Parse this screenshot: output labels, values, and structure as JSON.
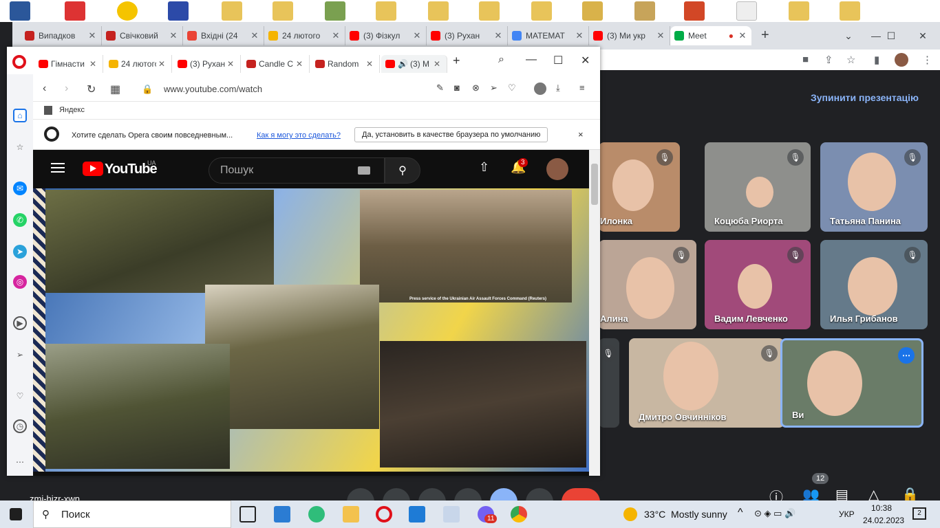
{
  "chrome": {
    "tabs": [
      {
        "label": "Випадков",
        "color": "#c5221f"
      },
      {
        "label": "Свічковий",
        "color": "#c5221f"
      },
      {
        "label": "Вхідні (24",
        "color": "#ea4335"
      },
      {
        "label": "24 лютого",
        "color": "#f5b400"
      },
      {
        "label": "(3) Фізкул",
        "color": "#ff0000"
      },
      {
        "label": "(3) Рухан",
        "color": "#ff0000"
      },
      {
        "label": "МАТЕМАТ",
        "color": "#4285f4"
      },
      {
        "label": "(3) Ми укр",
        "color": "#ff0000"
      },
      {
        "label": "Meet",
        "color": "#00ac47"
      }
    ],
    "new_tab": "+"
  },
  "meet": {
    "stop_presentation": "Зупинити презентацію",
    "participants_count": "12",
    "meeting_code": "zmj-hjzr-xwn",
    "participants": [
      {
        "name": "Илонка",
        "bg": "#b98c6a"
      },
      {
        "name": "Коцюба Риорта",
        "bg": "#8e8f8c"
      },
      {
        "name": "Татьяна Панина",
        "bg": "#7b8eb0"
      },
      {
        "name": "Алина",
        "bg": "#bba596"
      },
      {
        "name": "Вадим Левченко",
        "bg": "#a14a7a"
      },
      {
        "name": "Илья Грибанов",
        "bg": "#657a8a"
      },
      {
        "name": "Дмитро Овчинніков",
        "bg": "#c8b7a2"
      },
      {
        "name": "Ви",
        "bg": "#6a7c68"
      }
    ]
  },
  "opera": {
    "tabs": [
      {
        "label": "Гімнасти",
        "color": "#ff0000"
      },
      {
        "label": "24 лютого",
        "color": "#f5b400"
      },
      {
        "label": "(3) Рухан",
        "color": "#ff0000"
      },
      {
        "label": "Candle C",
        "color": "#c5221f"
      },
      {
        "label": "Random",
        "color": "#c5221f"
      },
      {
        "label": "(3) M",
        "color": "#ff0000"
      }
    ],
    "new_tab": "+",
    "url": "www.youtube.com/watch",
    "bookmark": "Яндекс",
    "infobar": {
      "question": "Хотите сделать Opera своим повседневным...",
      "link": "Как я могу это сделать?",
      "button": "Да, установить в качестве браузера по умолчанию",
      "close": "×"
    }
  },
  "youtube": {
    "logo": "YouTube",
    "region": "UA",
    "search_placeholder": "Пошук",
    "notifications": "3",
    "caption": "Press service of the Ukrainian Air Assault Forces Command (Reuters)"
  },
  "taskbar": {
    "search": "Поиск",
    "weather": "33°C  Mostly sunny",
    "lang": "УКР",
    "time": "10:38",
    "date": "24.02.2023",
    "notif_count": "2",
    "viber_count": "11"
  }
}
